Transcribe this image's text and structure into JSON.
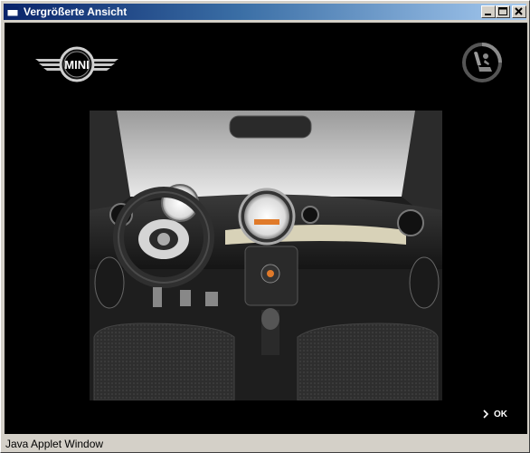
{
  "window": {
    "title": "Vergrößerte Ansicht",
    "status": "Java Applet Window"
  },
  "brand": {
    "logo_text": "MINI"
  },
  "actions": {
    "ok_label": "OK"
  },
  "icons": {
    "app": "java-applet-icon",
    "minimize": "minimize-icon",
    "maximize": "maximize-icon",
    "close": "close-icon",
    "view_toggle": "seat-view-icon",
    "ok_arrow": "chevron-right-icon"
  },
  "colors": {
    "background": "#000000",
    "titlebar_start": "#0a246a",
    "titlebar_end": "#a6caf0",
    "chrome": "#d4d0c8"
  }
}
